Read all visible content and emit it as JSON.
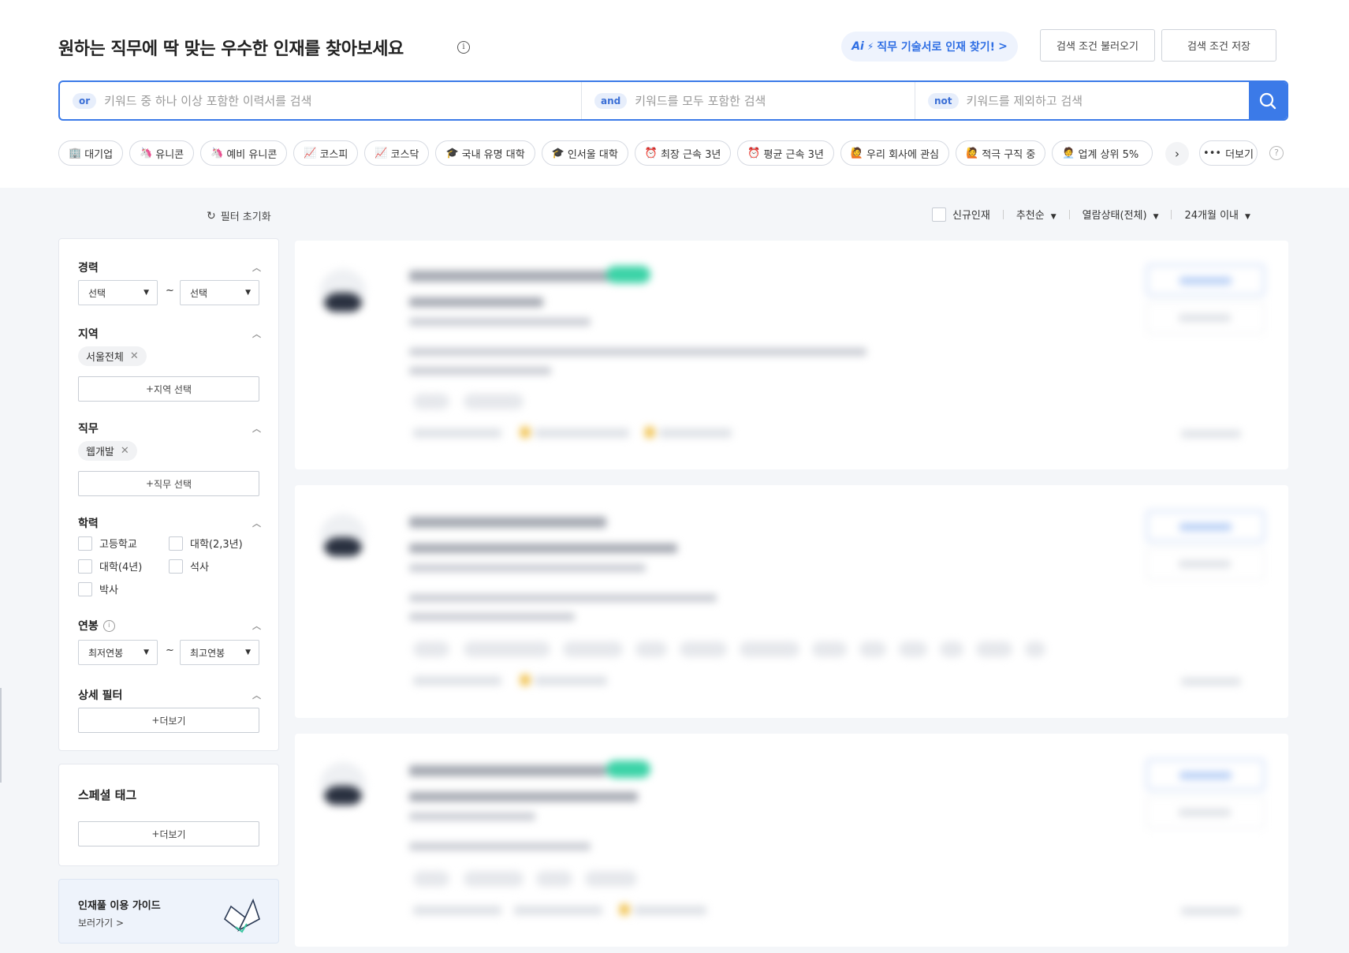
{
  "header": {
    "title": "원하는 직무에 딱 맞는 우수한 인재를 찾아보세요",
    "ai_button_ai": "Ai",
    "ai_button_label": "직무 기술서로 인재 찾기!",
    "ai_button_arrow": ">",
    "load_button": "검색 조건 불러오기",
    "save_button": "검색 조건 저장"
  },
  "search": {
    "or_tag": "or",
    "or_placeholder": "키워드 중 하나 이상 포함한 이력서를 검색",
    "and_tag": "and",
    "and_placeholder": "키워드를 모두 포함한 검색",
    "not_tag": "not",
    "not_placeholder": "키워드를 제외하고 검색"
  },
  "chips": [
    {
      "icon": "🏢",
      "label": "대기업"
    },
    {
      "icon": "🦄",
      "label": "유니콘"
    },
    {
      "icon": "🦄",
      "label": "예비 유니콘"
    },
    {
      "icon": "📈",
      "label": "코스피"
    },
    {
      "icon": "📈",
      "label": "코스닥"
    },
    {
      "icon": "🎓",
      "label": "국내 유명 대학"
    },
    {
      "icon": "🎓",
      "label": "인서울 대학"
    },
    {
      "icon": "⏰",
      "label": "최장 근속 3년"
    },
    {
      "icon": "⏰",
      "label": "평균 근속 3년"
    },
    {
      "icon": "🙋",
      "label": "우리 회사에 관심"
    },
    {
      "icon": "🙋",
      "label": "적극 구직 중"
    },
    {
      "icon": "🧑‍💼",
      "label": "업계 상위 5%"
    }
  ],
  "chips_more": "더보기",
  "toolbar": {
    "reset": "필터 초기화",
    "new_talent": "신규인재",
    "sort": "추천순",
    "view_status": "열람상태(전체)",
    "period": "24개월 이내"
  },
  "filters": {
    "career": {
      "title": "경력",
      "from": "선택",
      "to": "선택",
      "tilde": "~"
    },
    "region": {
      "title": "지역",
      "tag": "서울전체",
      "add": "지역 선택"
    },
    "job": {
      "title": "직무",
      "tag": "웹개발",
      "add": "직무 선택"
    },
    "education": {
      "title": "학력",
      "options": [
        "고등학교",
        "대학(2,3년)",
        "대학(4년)",
        "석사",
        "박사"
      ]
    },
    "salary": {
      "title": "연봉",
      "min": "최저연봉",
      "max": "최고연봉",
      "tilde": "~"
    },
    "detail": {
      "title": "상세 필터",
      "add": "더보기"
    }
  },
  "special": {
    "title": "스페셜 태그",
    "add": "더보기"
  },
  "guide": {
    "title": "인재풀 이용 가이드",
    "link": "보러가기 >"
  }
}
